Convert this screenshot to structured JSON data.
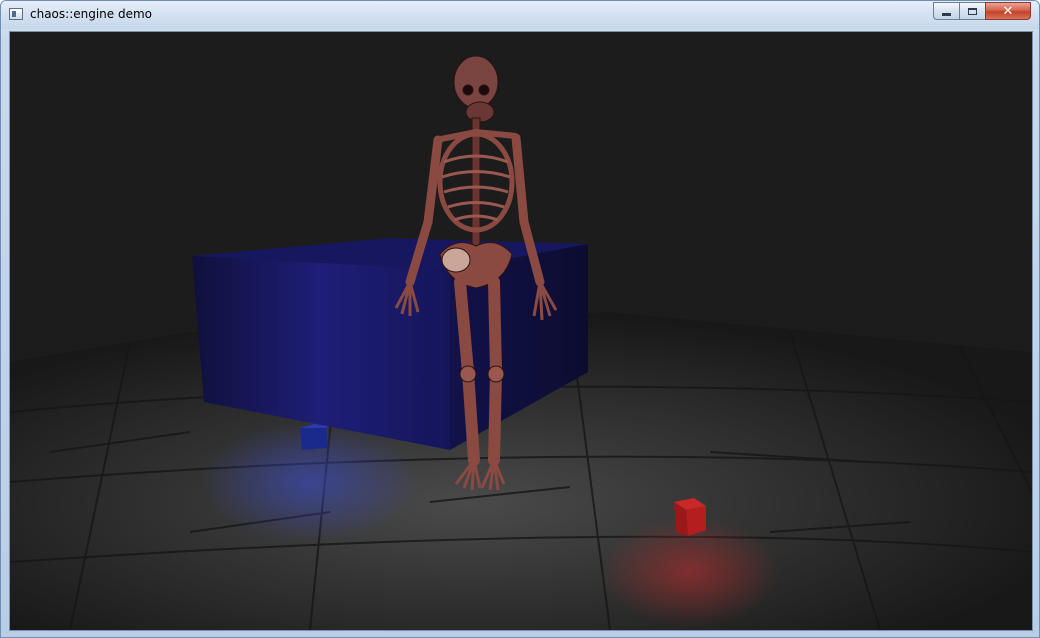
{
  "window": {
    "title": "chaos::engine demo",
    "icons": {
      "app": "app-window-icon",
      "minimize": "minimize-icon",
      "maximize": "maximize-icon",
      "close": "close-icon"
    },
    "close_glyph": "✕"
  },
  "scene": {
    "background_color": "#1c1c1c",
    "floor_color": "#3a3a3a",
    "box_color": "#1a1a5c",
    "skeleton_color": "#8a4a42",
    "small_cube_blue": "#1a2a8c",
    "small_cube_red": "#b01c1c"
  }
}
